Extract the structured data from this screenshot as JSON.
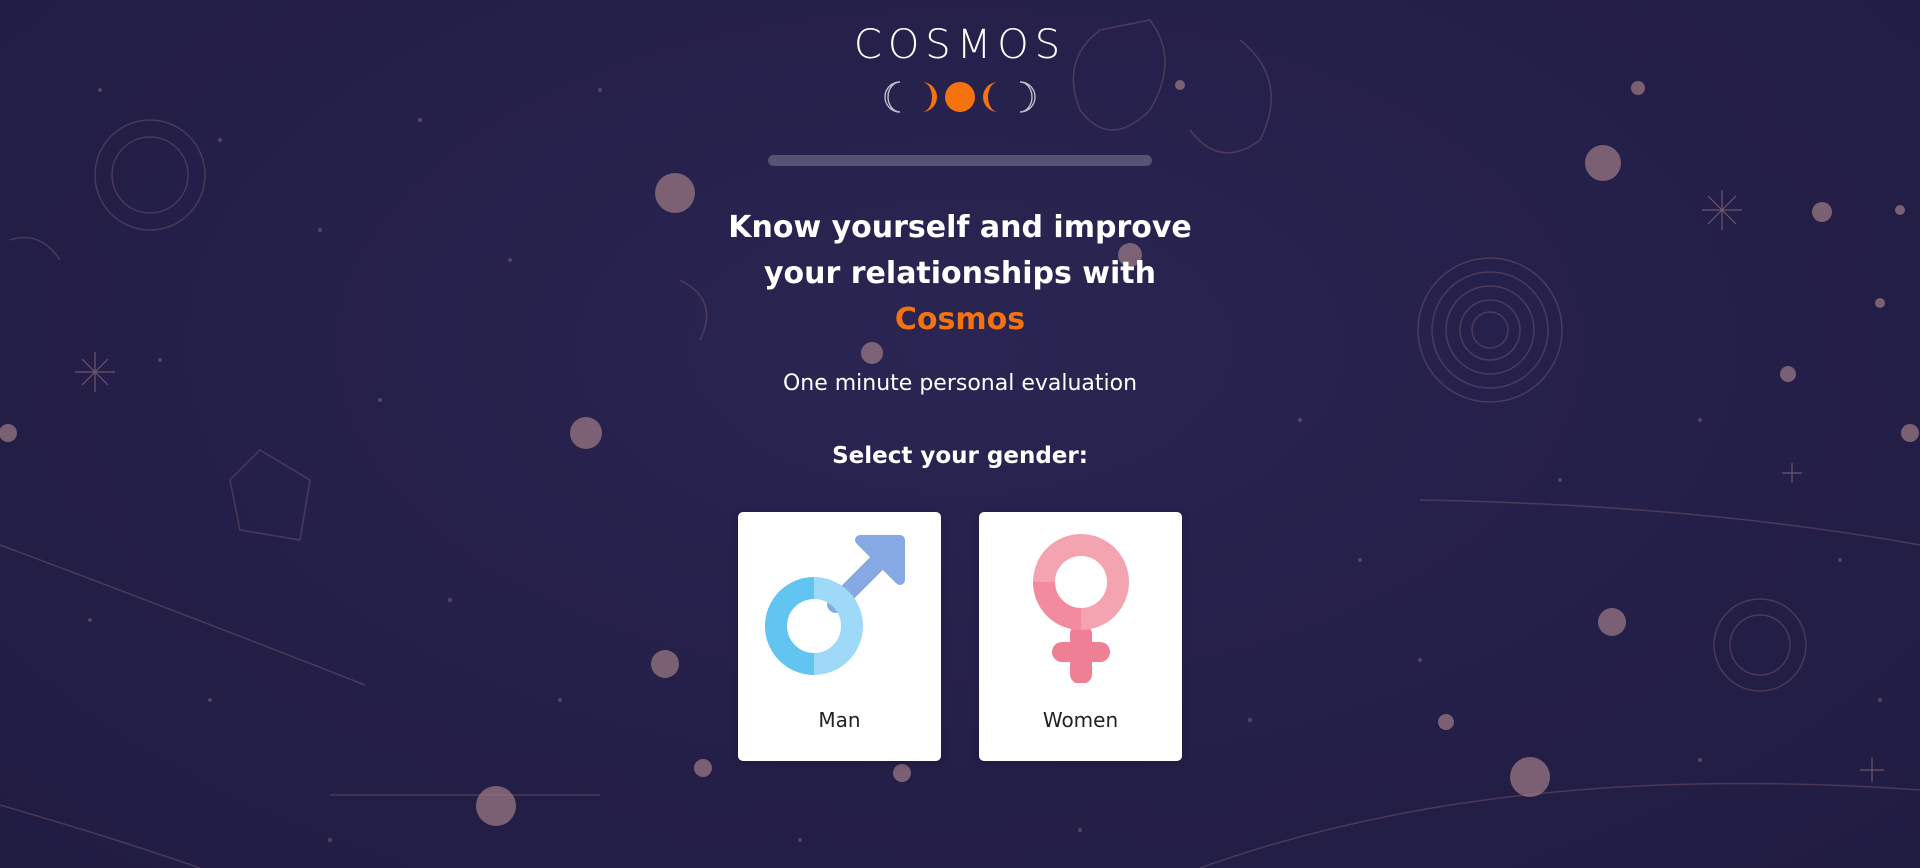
{
  "brand": {
    "name": "COSMOS",
    "accent_color": "#f5730f",
    "moon_icons": [
      "crescent-outline-icon",
      "crescent-icon",
      "full-moon-icon",
      "crescent-icon",
      "crescent-outline-icon"
    ]
  },
  "progress": {
    "value": 0
  },
  "headline": {
    "line1": "Know yourself and improve",
    "line2": "your relationships with",
    "accent": "Cosmos"
  },
  "subtitle": "One minute personal evaluation",
  "gender": {
    "prompt": "Select your gender:",
    "options": [
      {
        "label": "Man",
        "icon": "male-symbol-icon"
      },
      {
        "label": "Women",
        "icon": "female-symbol-icon"
      }
    ]
  },
  "colors": {
    "background": "#231f47",
    "male_icon": "#6fc8f2",
    "female_icon": "#f28a9a"
  }
}
